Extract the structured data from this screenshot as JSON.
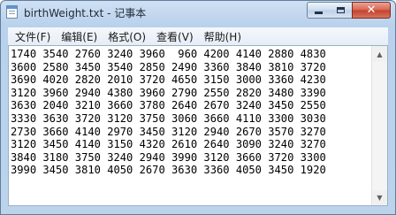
{
  "window": {
    "title": "birthWeight.txt - 记事本"
  },
  "icons": {
    "app": "notepad-icon",
    "minimize": "minimize-icon",
    "maximize": "maximize-icon",
    "close": "close-icon"
  },
  "controls": {
    "close_glyph": "✕"
  },
  "menu": [
    {
      "label": "文件(F)"
    },
    {
      "label": "编辑(E)"
    },
    {
      "label": "格式(O)"
    },
    {
      "label": "查看(V)"
    },
    {
      "label": "帮助(H)"
    }
  ],
  "scrollbar": {
    "up_glyph": "▲",
    "down_glyph": "▼"
  },
  "content": {
    "lines": [
      "1740 3540 2760 3240 3960  960 4200 4140 2880 4830",
      "3600 2580 3450 3540 2850 2490 3360 3840 3810 3720",
      "3690 4020 2820 2010 3720 4650 3150 3000 3360 4230",
      "3120 3960 2940 4380 3960 2790 2550 2820 3480 3390",
      "3630 2040 3210 3660 3780 2640 2670 3240 3450 2550",
      "3330 3630 3720 3120 3750 3060 3660 4110 3300 3030",
      "2730 3660 4140 2970 3450 3120 2940 2670 3570 3270",
      "3120 3450 4140 3150 4320 2610 2640 3090 3240 3270",
      "3840 3180 3750 3240 2940 3990 3120 3660 3720 3300",
      "3990 3450 3810 4050 2670 3630 3360 4050 3450 1920"
    ]
  }
}
